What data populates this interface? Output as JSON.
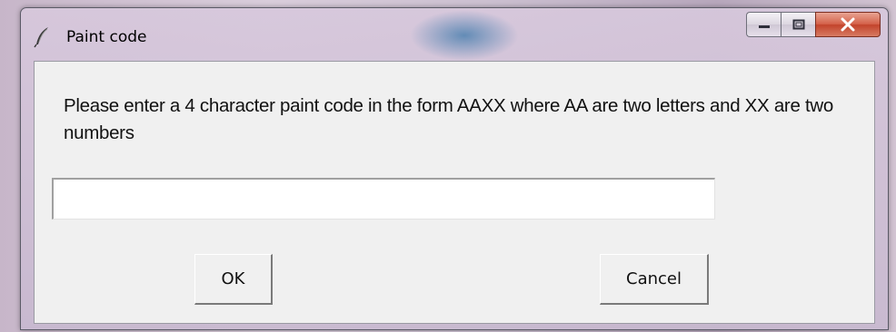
{
  "window": {
    "title": "Paint code",
    "icon": "feather-icon",
    "controls": [
      "minimize-icon",
      "maximize-icon",
      "close-icon"
    ]
  },
  "dialog": {
    "message": "Please enter a 4 character paint code in the form AAXX where AA are two letters and XX are two numbers",
    "input_value": "",
    "ok_label": "OK",
    "cancel_label": "Cancel"
  },
  "colors": {
    "close_button": "#c9503a",
    "client_background": "#f0f0f0"
  }
}
